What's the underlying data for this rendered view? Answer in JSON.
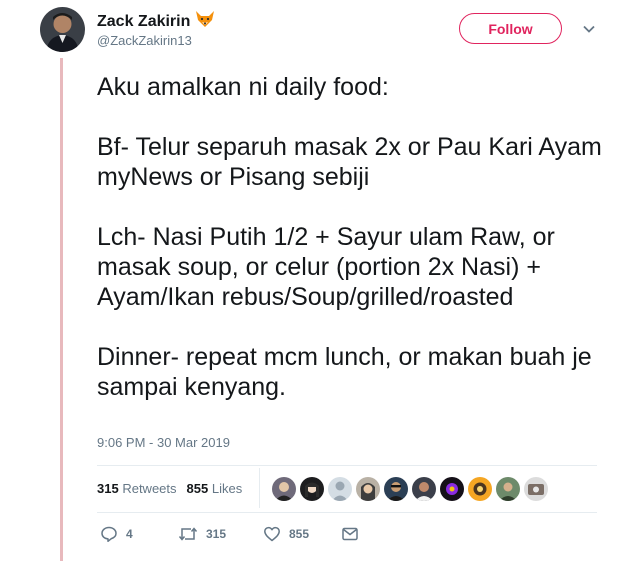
{
  "user": {
    "name": "Zack Zakirin",
    "handle": "@ZackZakirin13",
    "emoji_icon": "fox-face-icon"
  },
  "follow_label": "Follow",
  "tweet": {
    "lines": [
      "Aku amalkan ni daily food:",
      "Bf-  Telur separuh masak 2x or Pau Kari Ayam myNews or Pisang sebiji",
      "Lch- Nasi Putih 1/2 + Sayur ulam Raw, or masak soup, or celur (portion 2x Nasi) + Ayam/Ikan rebus/Soup/grilled/roasted",
      "Dinner- repeat mcm lunch, or makan buah je sampai kenyang."
    ],
    "timestamp": "9:06 PM - 30 Mar 2019"
  },
  "stats": {
    "retweets_count": "315",
    "retweets_label": "Retweets",
    "likes_count": "855",
    "likes_label": "Likes"
  },
  "actions": {
    "reply_count": "4",
    "retweet_count": "315",
    "like_count": "855"
  },
  "colors": {
    "accent": "#e0245e",
    "thread_line": "#e8b9bd",
    "muted": "#657786"
  }
}
